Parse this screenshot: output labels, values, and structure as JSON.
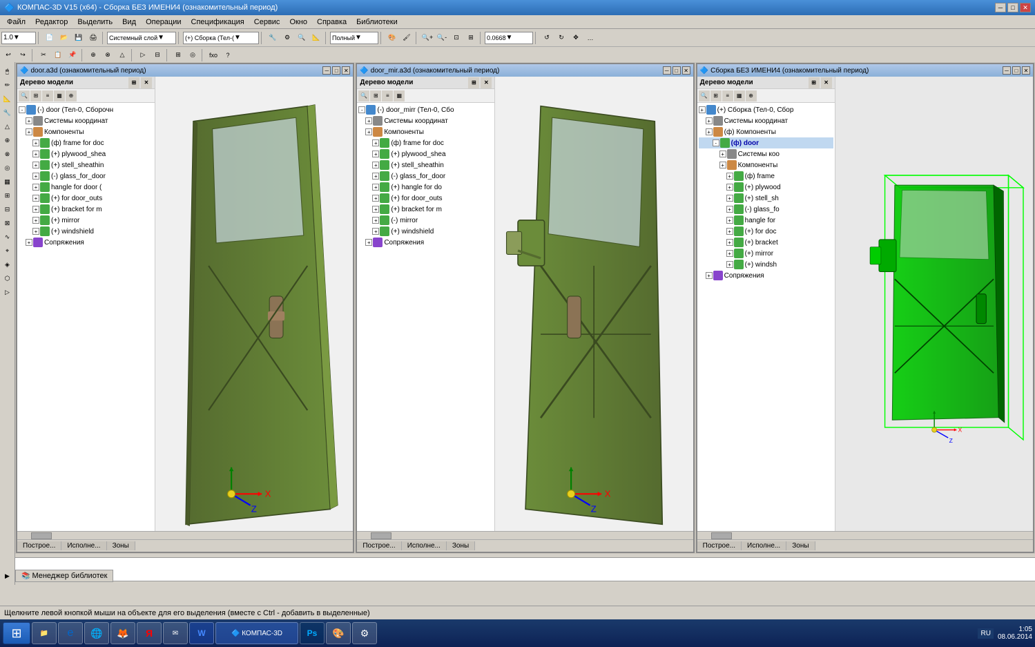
{
  "app": {
    "title": "КОМПАС-3D V15 (x64) - Сборка БЕЗ ИМЕНИ4 (ознакомительный период)"
  },
  "menu": {
    "items": [
      "Файл",
      "Редактор",
      "Выделить",
      "Вид",
      "Операции",
      "Спецификация",
      "Сервис",
      "Окно",
      "Справка",
      "Библиотеки"
    ]
  },
  "toolbar1": {
    "zoom_value": "1.0",
    "layer_label": "Системный слой",
    "assembly_label": "(+) Сборка (Тел-(",
    "view_label": "Полный",
    "scale_value": "0.0668"
  },
  "windows": [
    {
      "title": "door.a3d (ознакомительный период)",
      "tree_title": "Дерево модели",
      "tree_items": [
        {
          "indent": 0,
          "expand": "-",
          "icon": "assembly",
          "label": "(-) door (Тел-0, Сборочн",
          "level": 0
        },
        {
          "indent": 1,
          "expand": "+",
          "icon": "coord",
          "label": "Системы координат",
          "level": 1
        },
        {
          "indent": 1,
          "expand": "+",
          "icon": "comp",
          "label": "Компоненты",
          "level": 1
        },
        {
          "indent": 2,
          "expand": "+",
          "icon": "part",
          "label": "(ф) frame for doc",
          "level": 2
        },
        {
          "indent": 2,
          "expand": "+",
          "icon": "part",
          "label": "(+) plywood_shea",
          "level": 2
        },
        {
          "indent": 2,
          "expand": "+",
          "icon": "part",
          "label": "(+) stell_sheathin",
          "level": 2
        },
        {
          "indent": 2,
          "expand": "+",
          "icon": "part",
          "label": "(-) glass_for_door",
          "level": 2
        },
        {
          "indent": 2,
          "expand": "+",
          "icon": "part",
          "label": "hangle for door (",
          "level": 2
        },
        {
          "indent": 2,
          "expand": "+",
          "icon": "part",
          "label": "(+) for door_outs",
          "level": 2
        },
        {
          "indent": 2,
          "expand": "+",
          "icon": "part",
          "label": "(+) bracket for m",
          "level": 2
        },
        {
          "indent": 2,
          "expand": "+",
          "icon": "part",
          "label": "(+) mirror",
          "level": 2
        },
        {
          "indent": 2,
          "expand": "+",
          "icon": "part",
          "label": "(+) windshield",
          "level": 2
        },
        {
          "indent": 1,
          "expand": "+",
          "icon": "mate",
          "label": "Сопряжения",
          "level": 1
        }
      ],
      "tabs": [
        "Построе...",
        "Исполне...",
        "Зоны"
      ]
    },
    {
      "title": "door_mir.a3d (ознакомительный период)",
      "tree_title": "Дерево модели",
      "tree_items": [
        {
          "indent": 0,
          "expand": "-",
          "icon": "assembly",
          "label": "(-) door_mirr (Тел-0, Сбо",
          "level": 0
        },
        {
          "indent": 1,
          "expand": "+",
          "icon": "coord",
          "label": "Системы координат",
          "level": 1
        },
        {
          "indent": 1,
          "expand": "+",
          "icon": "comp",
          "label": "Компоненты",
          "level": 1
        },
        {
          "indent": 2,
          "expand": "+",
          "icon": "part",
          "label": "(ф) frame for doc",
          "level": 2
        },
        {
          "indent": 2,
          "expand": "+",
          "icon": "part",
          "label": "(+) plywood_shea",
          "level": 2
        },
        {
          "indent": 2,
          "expand": "+",
          "icon": "part",
          "label": "(+) stell_sheathin",
          "level": 2
        },
        {
          "indent": 2,
          "expand": "+",
          "icon": "part",
          "label": "(-) glass_for_door",
          "level": 2
        },
        {
          "indent": 2,
          "expand": "+",
          "icon": "part",
          "label": "(+) hangle for do",
          "level": 2
        },
        {
          "indent": 2,
          "expand": "+",
          "icon": "part",
          "label": "(+) for door_outs",
          "level": 2
        },
        {
          "indent": 2,
          "expand": "+",
          "icon": "part",
          "label": "(+) bracket for m",
          "level": 2
        },
        {
          "indent": 2,
          "expand": "+",
          "icon": "part",
          "label": "(-) mirror",
          "level": 2
        },
        {
          "indent": 2,
          "expand": "+",
          "icon": "part",
          "label": "(+) windshield",
          "level": 2
        },
        {
          "indent": 1,
          "expand": "+",
          "icon": "mate",
          "label": "Сопряжения",
          "level": 1
        }
      ],
      "tabs": [
        "Построе...",
        "Исполне...",
        "Зоны"
      ]
    },
    {
      "title": "Сборка БЕЗ ИМЕНИ4 (ознакомительный период)",
      "tree_title": "Дерево модели",
      "tree_items": [
        {
          "indent": 0,
          "expand": "+",
          "icon": "assembly",
          "label": "(+) Сборка (Тел-0, Сбор",
          "level": 0
        },
        {
          "indent": 1,
          "expand": "+",
          "icon": "coord",
          "label": "Системы координат",
          "level": 1
        },
        {
          "indent": 1,
          "expand": "+",
          "icon": "comp",
          "label": "(ф) Компоненты",
          "level": 1
        },
        {
          "indent": 2,
          "expand": "-",
          "icon": "part",
          "label": "(ф) door",
          "level": 2,
          "selected": true
        },
        {
          "indent": 3,
          "expand": "+",
          "icon": "coord",
          "label": "Системы коо",
          "level": 3
        },
        {
          "indent": 3,
          "expand": "+",
          "icon": "comp",
          "label": "Компоненты",
          "level": 3
        },
        {
          "indent": 4,
          "expand": "+",
          "icon": "part",
          "label": "(ф) frame",
          "level": 4
        },
        {
          "indent": 4,
          "expand": "+",
          "icon": "part",
          "label": "(+) plywood",
          "level": 4
        },
        {
          "indent": 4,
          "expand": "+",
          "icon": "part",
          "label": "(+) stell_sh",
          "level": 4
        },
        {
          "indent": 4,
          "expand": "+",
          "icon": "part",
          "label": "(-) glass_fo",
          "level": 4
        },
        {
          "indent": 4,
          "expand": "+",
          "icon": "part",
          "label": "hangle for",
          "level": 4
        },
        {
          "indent": 4,
          "expand": "+",
          "icon": "part",
          "label": "(+) for doc",
          "level": 4
        },
        {
          "indent": 4,
          "expand": "+",
          "icon": "part",
          "label": "(+) bracket",
          "level": 4
        },
        {
          "indent": 4,
          "expand": "+",
          "icon": "part",
          "label": "(+) mirror",
          "level": 4
        },
        {
          "indent": 4,
          "expand": "+",
          "icon": "part",
          "label": "(+) windsh",
          "level": 4
        },
        {
          "indent": 1,
          "expand": "+",
          "icon": "mate",
          "label": "Сопряжения",
          "level": 1
        }
      ],
      "tabs": [
        "Построе...",
        "Исполне...",
        "Зоны"
      ]
    }
  ],
  "status_bar": {
    "message": "Щелкните левой кнопкой мыши на объекте для его выделения (вместе с Ctrl - добавить в выделенные)"
  },
  "library_tab": {
    "label": "Менеджер библиотек"
  },
  "taskbar": {
    "start_label": "⊞",
    "apps": [
      "📁",
      "🌐",
      "🌐",
      "🌐",
      "🌐",
      "✉",
      "W",
      "K",
      "P",
      "🎨",
      "🎯"
    ],
    "lang": "RU",
    "time": "1:05",
    "date": "08.06.2014"
  }
}
